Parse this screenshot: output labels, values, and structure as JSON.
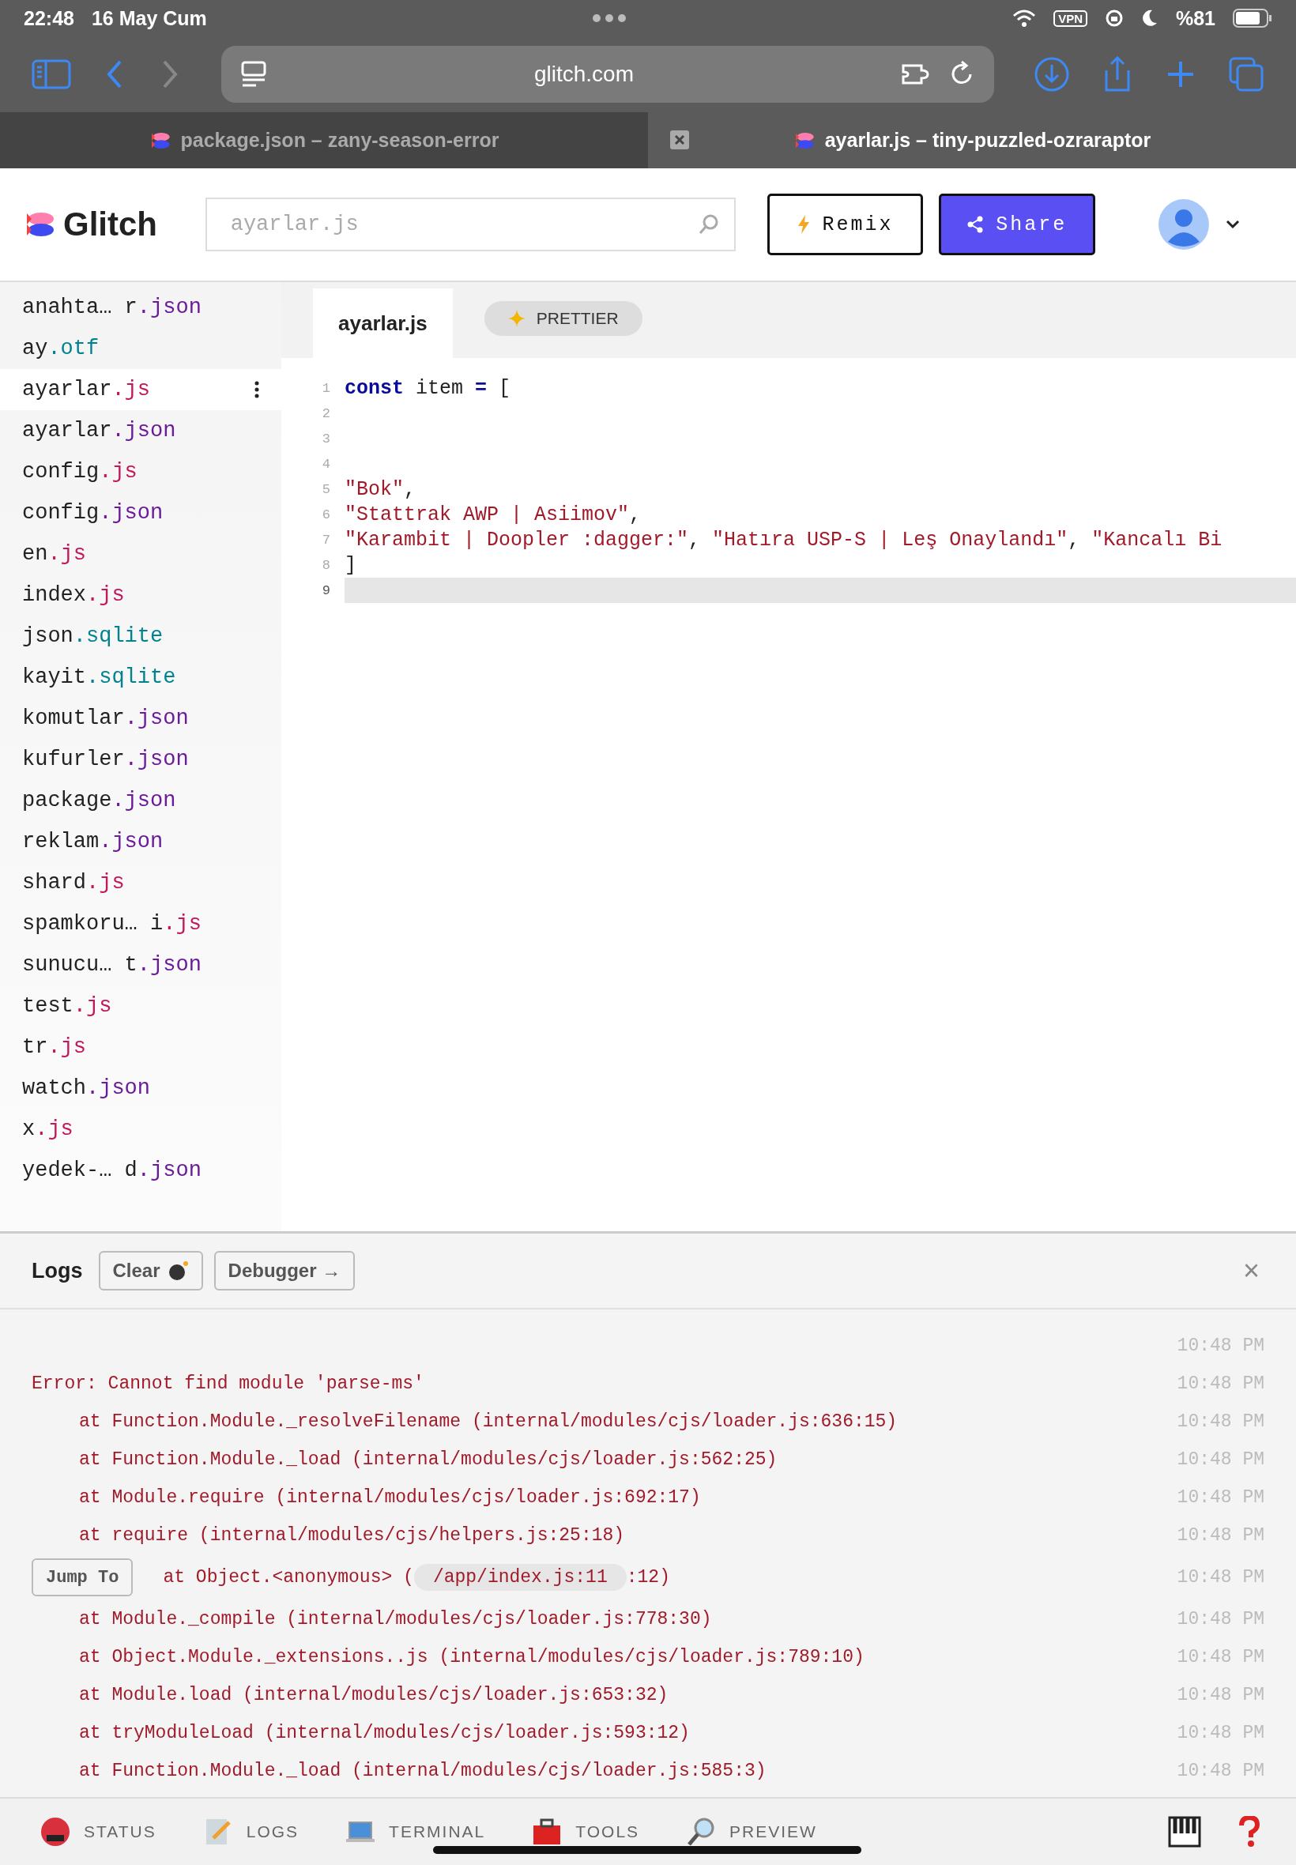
{
  "status_bar": {
    "time": "22:48",
    "date": "16 May Cum",
    "vpn": "VPN",
    "battery_text": "%81",
    "battery": {
      "level": 0.81
    }
  },
  "browser": {
    "url": "glitch.com",
    "tabs": [
      {
        "title": "package.json – zany-season-error",
        "selected": false
      },
      {
        "title": "ayarlar.js – tiny-puzzled-ozraraptor",
        "selected": true
      }
    ]
  },
  "header": {
    "logo": "Glitch",
    "search": {
      "placeholder": "ayarlar.js"
    },
    "remix": "Remix",
    "share": "Share"
  },
  "sidebar": {
    "files": [
      {
        "name": "anahta… r",
        "ext": ".json",
        "color": "#6a1b9a",
        "selected": false
      },
      {
        "name": "ay",
        "ext": ".otf",
        "color": "#00838f",
        "selected": false
      },
      {
        "name": "ayarlar",
        "ext": ".js",
        "color": "#c2185b",
        "selected": true
      },
      {
        "name": "ayarlar",
        "ext": ".json",
        "color": "#6a1b9a",
        "selected": false
      },
      {
        "name": "config",
        "ext": ".js",
        "color": "#c2185b",
        "selected": false
      },
      {
        "name": "config",
        "ext": ".json",
        "color": "#6a1b9a",
        "selected": false
      },
      {
        "name": "en",
        "ext": ".js",
        "color": "#c2185b",
        "selected": false
      },
      {
        "name": "index",
        "ext": ".js",
        "color": "#c2185b",
        "selected": false
      },
      {
        "name": "json",
        "ext": ".sqlite",
        "color": "#00838f",
        "selected": false
      },
      {
        "name": "kayit",
        "ext": ".sqlite",
        "color": "#00838f",
        "selected": false
      },
      {
        "name": "komutlar",
        "ext": ".json",
        "color": "#6a1b9a",
        "selected": false
      },
      {
        "name": "kufurler",
        "ext": ".json",
        "color": "#6a1b9a",
        "selected": false
      },
      {
        "name": "package",
        "ext": ".json",
        "color": "#6a1b9a",
        "selected": false
      },
      {
        "name": "reklam",
        "ext": ".json",
        "color": "#6a1b9a",
        "selected": false
      },
      {
        "name": "shard",
        "ext": ".js",
        "color": "#c2185b",
        "selected": false
      },
      {
        "name": "spamkoru… i",
        "ext": ".js",
        "color": "#c2185b",
        "selected": false
      },
      {
        "name": "sunucu… t",
        "ext": ".json",
        "color": "#6a1b9a",
        "selected": false
      },
      {
        "name": "test",
        "ext": ".js",
        "color": "#c2185b",
        "selected": false
      },
      {
        "name": "tr",
        "ext": ".js",
        "color": "#c2185b",
        "selected": false
      },
      {
        "name": "watch",
        "ext": ".json",
        "color": "#6a1b9a",
        "selected": false
      },
      {
        "name": "x",
        "ext": ".js",
        "color": "#c2185b",
        "selected": false
      },
      {
        "name": "yedek-… d",
        "ext": ".json",
        "color": "#6a1b9a",
        "selected": false
      }
    ]
  },
  "editor": {
    "tab": "ayarlar.js",
    "prettier": "PRETTIER",
    "lines": [
      {
        "number": "1",
        "active": false,
        "tokens": [
          {
            "kind": "keyword",
            "text": "const"
          },
          {
            "kind": "plain",
            "text": " item "
          },
          {
            "kind": "keyword",
            "text": "="
          },
          {
            "kind": "plain",
            "text": " ["
          }
        ]
      },
      {
        "number": "2",
        "active": false
      },
      {
        "number": "3",
        "active": false
      },
      {
        "number": "4",
        "active": false
      },
      {
        "number": "5",
        "active": false,
        "tokens": [
          {
            "kind": "string",
            "text": "\"Bok\""
          },
          {
            "kind": "plain",
            "text": ","
          }
        ]
      },
      {
        "number": "6",
        "active": false,
        "tokens": [
          {
            "kind": "string",
            "text": "\"Stattrak AWP | Asiimov\""
          },
          {
            "kind": "plain",
            "text": ","
          }
        ]
      },
      {
        "number": "7",
        "active": false,
        "tokens": [
          {
            "kind": "string",
            "text": "\"Karambit | Doopler :dagger:\""
          },
          {
            "kind": "plain",
            "text": ", "
          },
          {
            "kind": "string",
            "text": "\"Hatıra USP-S | Leş Onaylandı\""
          },
          {
            "kind": "plain",
            "text": ", "
          },
          {
            "kind": "string",
            "text": "\"Kancalı Bi"
          }
        ]
      },
      {
        "number": "8",
        "active": false,
        "tokens": [
          {
            "kind": "plain",
            "text": "]"
          }
        ]
      },
      {
        "number": "9",
        "active": true
      }
    ]
  },
  "logs": {
    "title": "Logs",
    "clear": "Clear",
    "debugger": "Debugger →",
    "close": "×",
    "lines": [
      {
        "kind": "blank",
        "time": "10:48 PM"
      },
      {
        "kind": "error",
        "text": "Error: Cannot find module 'parse-ms'",
        "time": "10:48 PM"
      },
      {
        "kind": "stack",
        "text": "at Function.Module._resolveFilename (internal/modules/cjs/loader.js:636:15)",
        "time": "10:48 PM"
      },
      {
        "kind": "stack",
        "text": "at Function.Module._load (internal/modules/cjs/loader.js:562:25)",
        "time": "10:48 PM"
      },
      {
        "kind": "stack",
        "text": "at Module.require (internal/modules/cjs/loader.js:692:17)",
        "time": "10:48 PM"
      },
      {
        "kind": "stack",
        "text": "at require (internal/modules/cjs/helpers.js:25:18)",
        "time": "10:48 PM"
      },
      {
        "kind": "jump",
        "jump": "Jump To",
        "before": "at Object.<anonymous> (",
        "link": "/app/index.js:11",
        "after": ":12)",
        "time": "10:48 PM"
      },
      {
        "kind": "stack",
        "text": "at Module._compile (internal/modules/cjs/loader.js:778:30)",
        "time": "10:48 PM"
      },
      {
        "kind": "stack",
        "text": "at Object.Module._extensions..js (internal/modules/cjs/loader.js:789:10)",
        "time": "10:48 PM"
      },
      {
        "kind": "stack",
        "text": "at Module.load (internal/modules/cjs/loader.js:653:32)",
        "time": "10:48 PM"
      },
      {
        "kind": "stack",
        "text": "at tryModuleLoad (internal/modules/cjs/loader.js:593:12)",
        "time": "10:48 PM"
      },
      {
        "kind": "stack",
        "text": "at Function.Module._load (internal/modules/cjs/loader.js:585:3)",
        "time": "10:48 PM"
      }
    ]
  },
  "toolbar": {
    "items": [
      {
        "kind": "status",
        "label": "STATUS"
      },
      {
        "kind": "logs",
        "label": "LOGS"
      },
      {
        "kind": "terminal",
        "label": "TERMINAL"
      },
      {
        "kind": "tools",
        "label": "TOOLS"
      },
      {
        "kind": "preview",
        "label": "PREVIEW"
      }
    ]
  }
}
